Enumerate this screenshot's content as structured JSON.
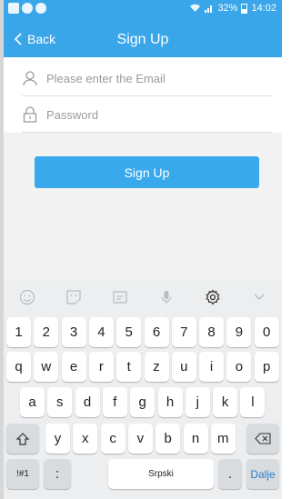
{
  "status": {
    "battery_text": "32%",
    "time": "14:02"
  },
  "nav": {
    "back_label": "Back",
    "title": "Sign Up"
  },
  "form": {
    "email_placeholder": "Please enter the Email",
    "password_placeholder": "Password",
    "signup_label": "Sign Up"
  },
  "keyboard": {
    "row1": [
      "1",
      "2",
      "3",
      "4",
      "5",
      "6",
      "7",
      "8",
      "9",
      "0"
    ],
    "row2": [
      "q",
      "w",
      "e",
      "r",
      "t",
      "z",
      "u",
      "i",
      "o",
      "p"
    ],
    "row3": [
      "a",
      "s",
      "d",
      "f",
      "g",
      "h",
      "j",
      "k",
      "l"
    ],
    "row4": [
      "y",
      "x",
      "c",
      "v",
      "b",
      "n",
      "m"
    ],
    "symbols_label": "!#1",
    "colon_label": ":",
    "space_label": "Srpski",
    "period_label": ".",
    "enter_label": "Dalje"
  },
  "colors": {
    "accent": "#3aa6ea"
  }
}
